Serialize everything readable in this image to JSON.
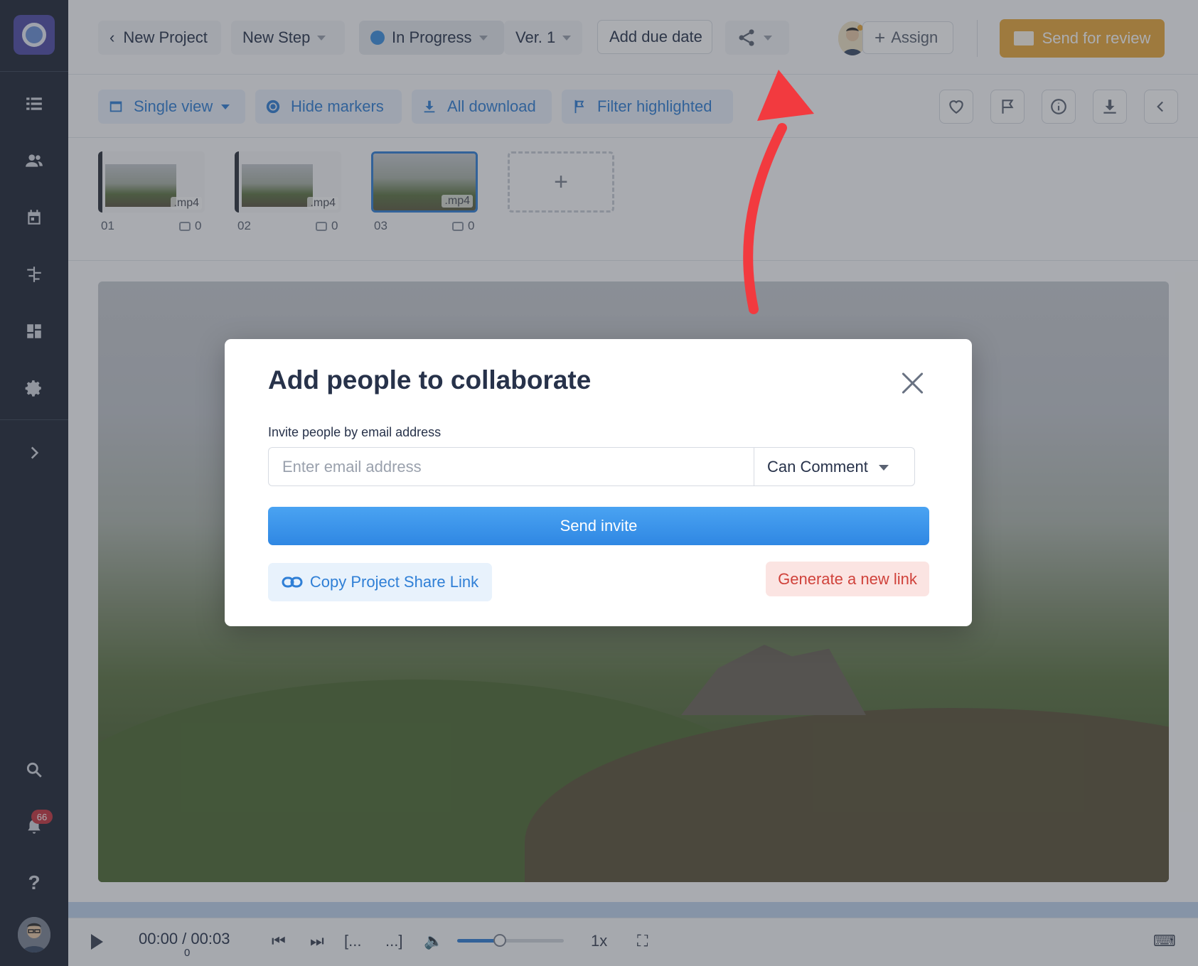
{
  "header": {
    "back_label": "New Project",
    "step_label": "New Step",
    "status_label": "In Progress",
    "version_label": "Ver. 1",
    "due_date_label": "Add due date",
    "assign_label": "Assign",
    "send_review_label": "Send for review"
  },
  "toolbar": {
    "single_view_label": "Single view",
    "hide_markers_label": "Hide markers",
    "all_download_label": "All download",
    "filter_highlighted_label": "Filter highlighted"
  },
  "thumbnails": [
    {
      "number": "01",
      "ext": ".mp4",
      "comments": "0"
    },
    {
      "number": "02",
      "ext": ".mp4",
      "comments": "0"
    },
    {
      "number": "03",
      "ext": ".mp4",
      "comments": "0"
    }
  ],
  "add_thumb_label": "+",
  "player": {
    "time": "00:00 / 00:03",
    "time_sub": "0",
    "in_bracket": "[...",
    "out_bracket": "...]",
    "speed": "1x",
    "volume_fraction": 0.4
  },
  "sidebar": {
    "notification_count": "66"
  },
  "modal": {
    "title": "Add people to collaborate",
    "invite_label": "Invite people by email address",
    "email_placeholder": "Enter email address",
    "permission_value": "Can Comment",
    "send_invite_label": "Send invite",
    "copy_link_label": "Copy Project Share Link",
    "generate_link_label": "Generate a new link"
  },
  "colors": {
    "accent_blue": "#2f7fd6",
    "send_review_orange": "#e8a73a",
    "generate_link_red": "#d0423b",
    "annotation_arrow_red": "#f23a3f",
    "sidebar_dark": "#1e2535"
  },
  "icons": {
    "sidebar": [
      "list-icon",
      "users-icon",
      "calendar-icon",
      "tasks-icon",
      "dashboard-icon",
      "settings-icon",
      "chevron-right-icon",
      "search-icon",
      "bell-icon",
      "help-icon"
    ],
    "toolbar_right": [
      "heart-icon",
      "flag-icon",
      "info-icon",
      "download-icon",
      "chevron-left-icon"
    ]
  }
}
